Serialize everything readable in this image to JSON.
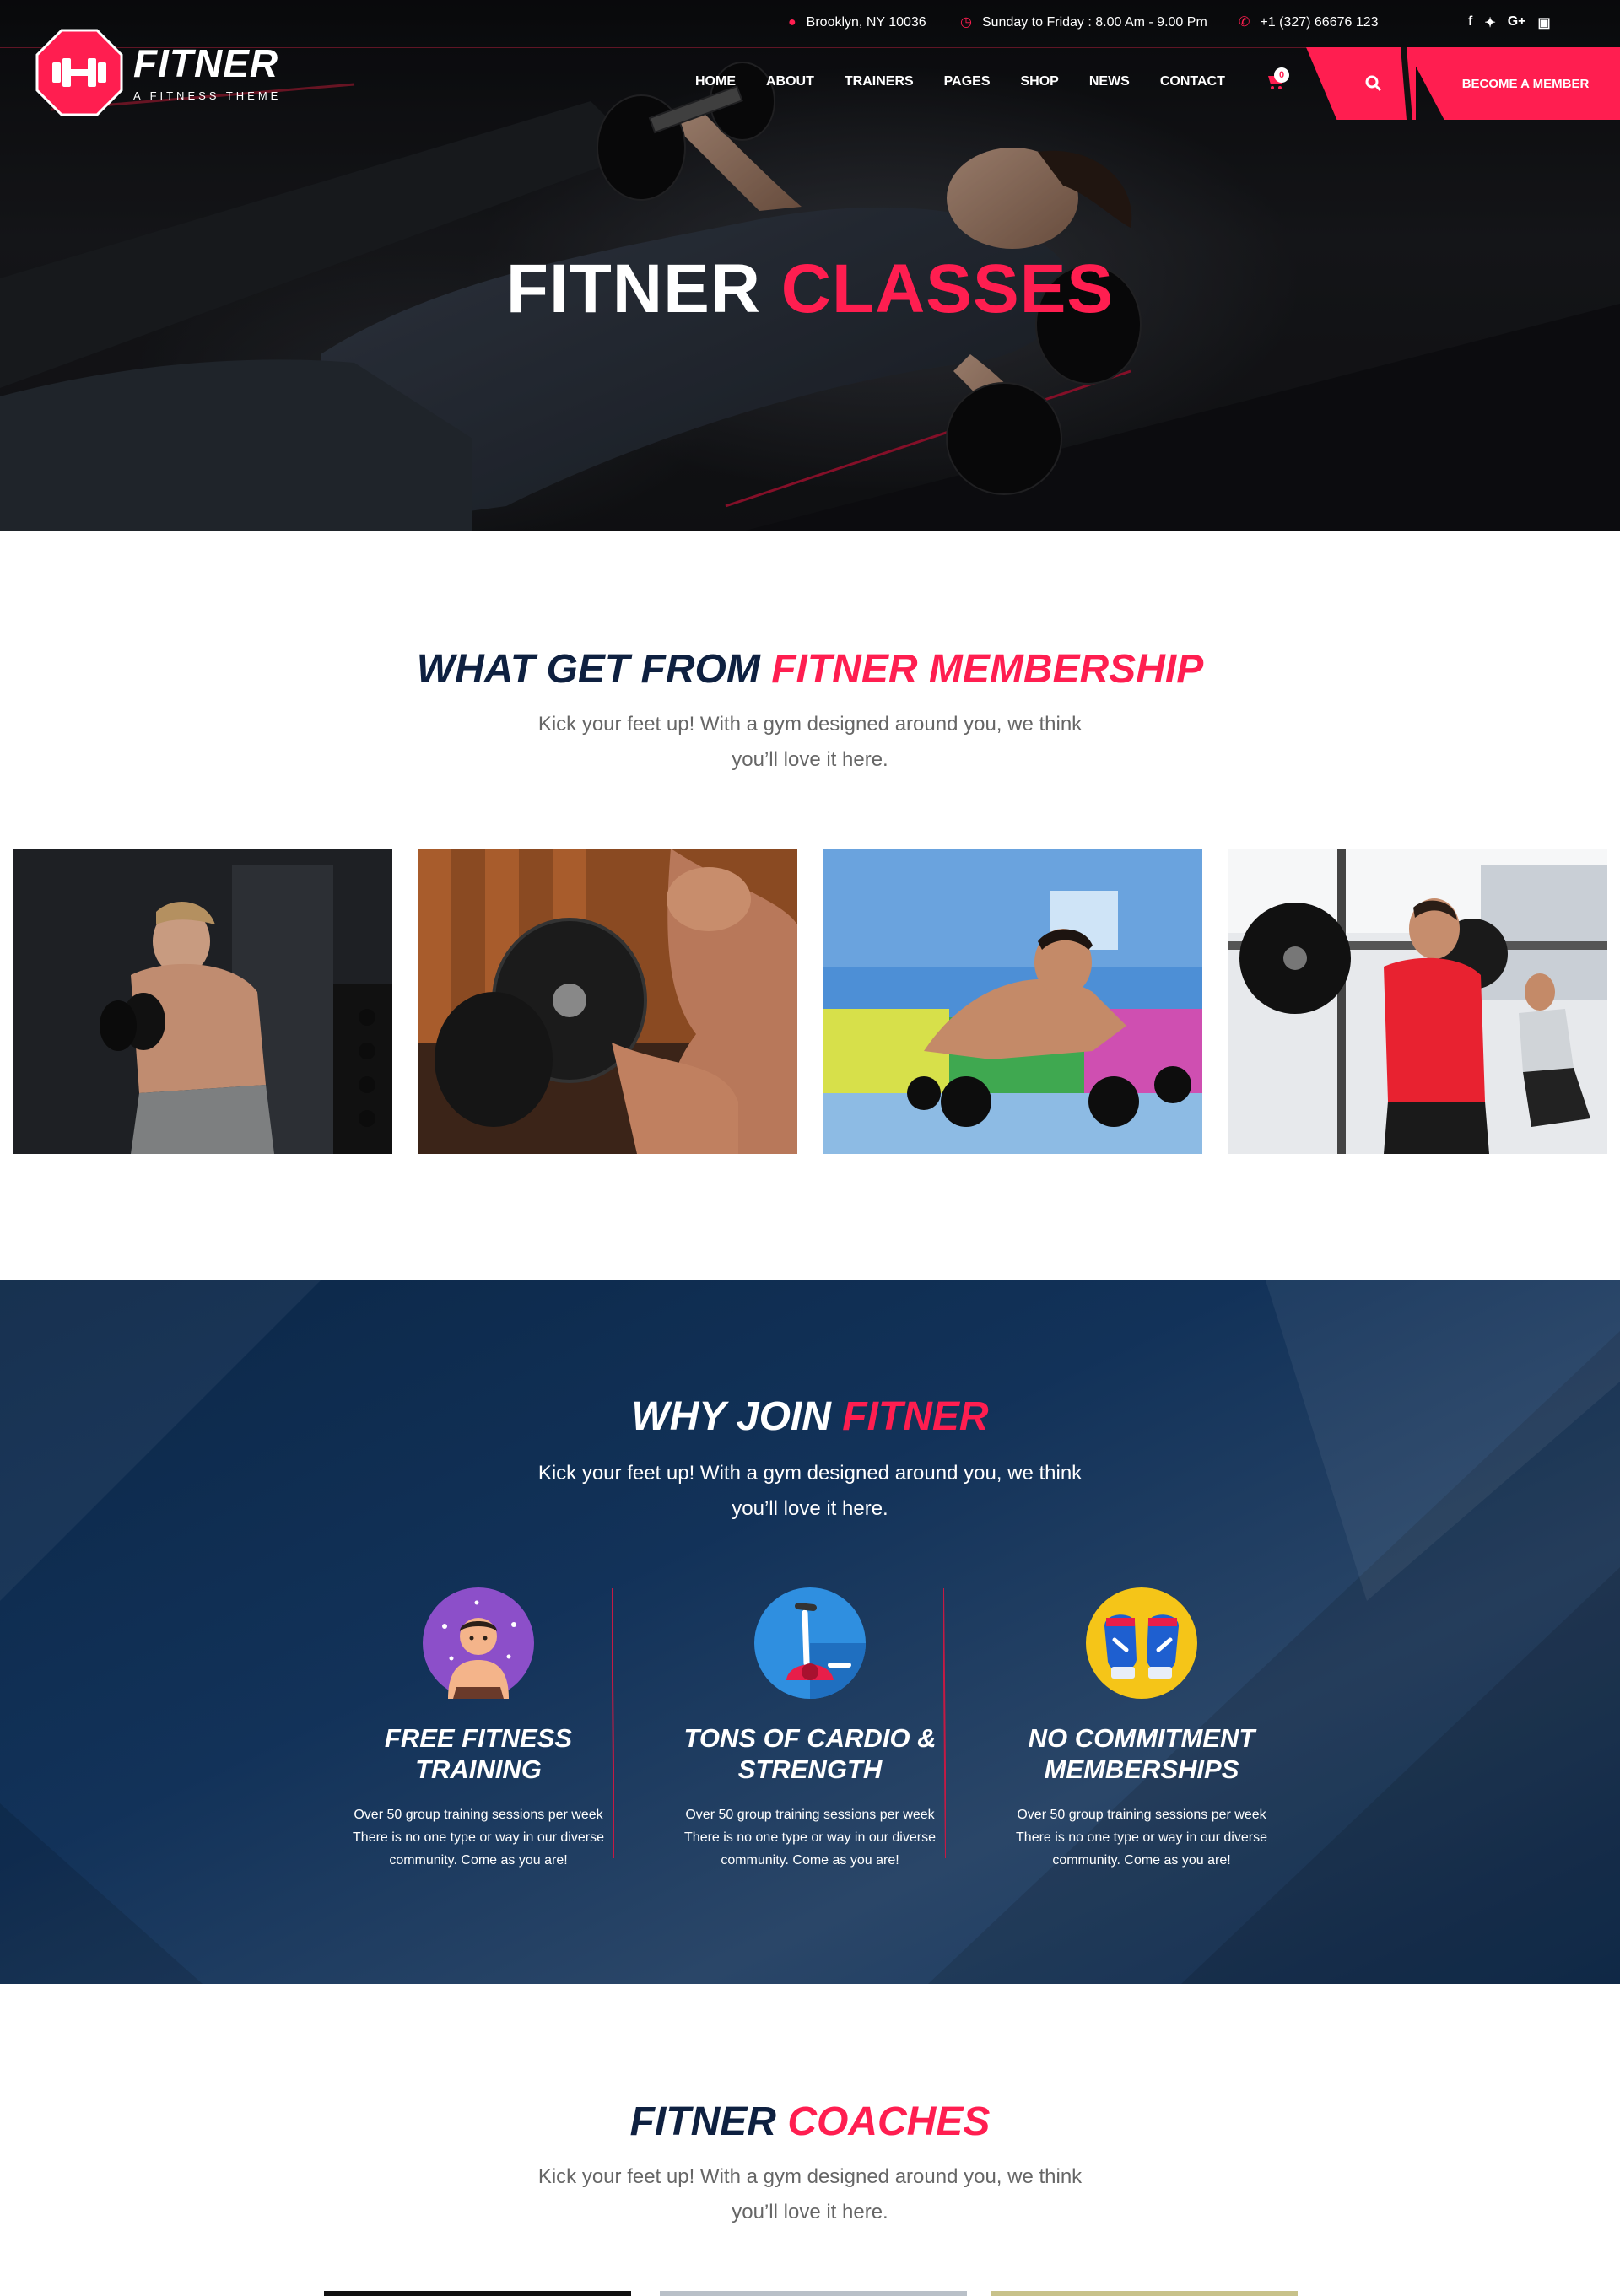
{
  "colors": {
    "accent": "#ff1e50",
    "navy": "#0e2040",
    "text_muted": "#666666"
  },
  "topbar": {
    "location": "Brooklyn, NY 10036",
    "hours": "Sunday to Friday : 8.00 Am - 9.00 Pm",
    "phone": "+1 (327) 66676 123",
    "location_icon": "map-pin-icon",
    "hours_icon": "clock-icon",
    "phone_icon": "phone-icon",
    "socials": [
      "f",
      "t",
      "G+",
      "ig"
    ]
  },
  "brand": {
    "name": "FITNER",
    "tagline": "A FITNESS THEME"
  },
  "nav": [
    "HOME",
    "ABOUT",
    "TRAINERS",
    "PAGES",
    "SHOP",
    "NEWS",
    "CONTACT"
  ],
  "cart": {
    "count": "0"
  },
  "cta": {
    "member": "BECOME A MEMBER"
  },
  "hero": {
    "title_main": "FITNER",
    "title_accent": "CLASSES"
  },
  "membership": {
    "title_main": "WHAT GET FROM",
    "title_accent": "FITNER MEMBERSHIP",
    "subtitle": "Kick your feet up! With a gym designed around you, we think you’ll love it here."
  },
  "why": {
    "title_main": "WHY JOIN",
    "title_accent": "FITNER",
    "subtitle": "Kick your feet up! With a gym designed around you, we think you’ll love it here.",
    "features": [
      {
        "title": "FREE FITNESS TRAINING",
        "desc": "Over 50 group training sessions per week There is no one type or way in our diverse community. Come as you are!",
        "icon": "trainer-icon"
      },
      {
        "title": "TONS OF CARDIO & STRENGTH",
        "desc": "Over 50 group training sessions per week There is no one type or way in our diverse community. Come as you are!",
        "icon": "exercise-bike-icon"
      },
      {
        "title": "NO COMMITMENT MEMBERSHIPS",
        "desc": "Over 50 group training sessions per week There is no one type or way in our diverse community. Come as you are!",
        "icon": "boxing-gloves-icon"
      }
    ]
  },
  "coaches": {
    "title_main": "FITNER",
    "title_accent": "COACHES",
    "subtitle": "Kick your feet up! With a gym designed around you, we think you’ll love it here."
  }
}
